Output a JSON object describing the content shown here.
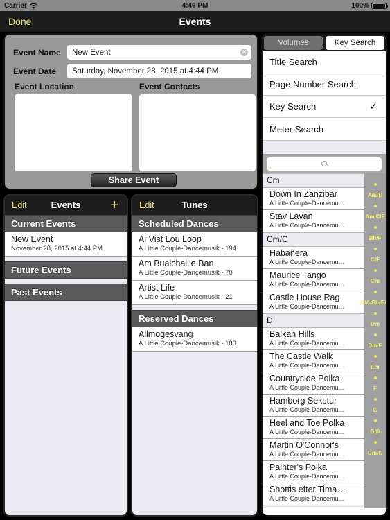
{
  "statusbar": {
    "carrier": "Carrier",
    "wifi_icon": "wifi-icon",
    "time": "4:46 PM",
    "battery_percent": "100%"
  },
  "navbar": {
    "done_label": "Done",
    "title": "Events"
  },
  "accent_color": "#e8e37a",
  "event_form": {
    "name_label": "Event Name",
    "name_value": "New Event",
    "name_placeholder": "Event Name",
    "clear_icon": "clear-circle-icon",
    "date_label": "Event Date",
    "date_value": "Saturday, November 28, 2015 at 4:44 PM",
    "location_label": "Event Location",
    "location_value": "",
    "contacts_label": "Event Contacts",
    "contacts_value": "",
    "share_label": "Share Event"
  },
  "events_panel": {
    "edit_label": "Edit",
    "title": "Events",
    "add_icon": "plus-icon",
    "sections": [
      {
        "header": "Current Events",
        "rows": [
          {
            "title": "New Event",
            "subtitle": "November 28, 2015 at 4:44 PM"
          }
        ]
      },
      {
        "header": "Future Events",
        "rows": []
      },
      {
        "header": "Past Events",
        "rows": []
      }
    ]
  },
  "tunes_panel": {
    "edit_label": "Edit",
    "title": "Tunes",
    "sections": [
      {
        "header": "Scheduled Dances",
        "rows": [
          {
            "title": "Ai Vist Lou Loop",
            "subtitle": "A Little Couple-Dancemusik - 194"
          },
          {
            "title": "Am Buaichaille Ban",
            "subtitle": "A Little Couple-Dancemusik - 70"
          },
          {
            "title": "Artist Life",
            "subtitle": "A Little Couple-Dancemusik - 21"
          }
        ]
      },
      {
        "header": "Reserved Dances",
        "rows": [
          {
            "title": "Allmogesvang",
            "subtitle": "A Little Couple-Dancemusik - 183"
          }
        ]
      }
    ]
  },
  "right_panel": {
    "segments": [
      {
        "label": "Volumes",
        "selected": false
      },
      {
        "label": "Key Search",
        "selected": true
      }
    ],
    "options": [
      {
        "label": "Title Search",
        "checked": false
      },
      {
        "label": "Page Number Search",
        "checked": false
      },
      {
        "label": "Key Search",
        "checked": true
      },
      {
        "label": "Meter Search",
        "checked": false
      }
    ],
    "check_icon": "checkmark-icon",
    "search": {
      "placeholder": "",
      "value": "",
      "icon": "search-icon"
    },
    "key_sections": [
      {
        "header": "Cm",
        "rows": [
          {
            "title": "Down In Zanzibar",
            "subtitle": "A Little Couple-Dancemu…"
          },
          {
            "title": "Stav Lavan",
            "subtitle": "A Little Couple-Dancemu…"
          }
        ]
      },
      {
        "header": "Cm/C",
        "rows": [
          {
            "title": "Habañera",
            "subtitle": "A Little Couple-Dancemu…"
          },
          {
            "title": "Maurice Tango",
            "subtitle": "A Little Couple-Dancemu…"
          },
          {
            "title": "Castle House Rag",
            "subtitle": "A Little Couple-Dancemu…"
          }
        ]
      },
      {
        "header": "D",
        "rows": [
          {
            "title": "Balkan Hills",
            "subtitle": "A Little Couple-Dancemu…"
          },
          {
            "title": "The Castle Walk",
            "subtitle": "A Little Couple-Dancemu…"
          },
          {
            "title": "Countryside Polka",
            "subtitle": "A Little Couple-Dancemu…"
          },
          {
            "title": "Hamborg Sekstur",
            "subtitle": "A Little Couple-Dancemu…"
          },
          {
            "title": "Heel and Toe Polka",
            "subtitle": "A Little Couple-Dancemu…"
          },
          {
            "title": "Martin O'Connor's",
            "subtitle": "A Little Couple-Dancemu…"
          },
          {
            "title": "Painter's Polka",
            "subtitle": "A Little Couple-Dancemu…"
          },
          {
            "title": "Shottis efter Tima…",
            "subtitle": "A Little Couple-Dancemu…"
          }
        ]
      }
    ],
    "index_entries": [
      {
        "type": "dot"
      },
      {
        "type": "label",
        "label": "A/E/D"
      },
      {
        "type": "dot"
      },
      {
        "type": "label",
        "label": "Am/C/F"
      },
      {
        "type": "dot"
      },
      {
        "type": "label",
        "label": "Bb/F"
      },
      {
        "type": "dot"
      },
      {
        "type": "label",
        "label": "C/F"
      },
      {
        "type": "dot"
      },
      {
        "type": "label",
        "label": "Cm"
      },
      {
        "type": "dot"
      },
      {
        "type": "label",
        "label": "D/A/Bb/G/F"
      },
      {
        "type": "dot"
      },
      {
        "type": "label",
        "label": "Dm"
      },
      {
        "type": "dot"
      },
      {
        "type": "label",
        "label": "Dm/F"
      },
      {
        "type": "dot"
      },
      {
        "type": "label",
        "label": "Em"
      },
      {
        "type": "dot"
      },
      {
        "type": "label",
        "label": "F"
      },
      {
        "type": "dot"
      },
      {
        "type": "label",
        "label": "G"
      },
      {
        "type": "dot"
      },
      {
        "type": "label",
        "label": "G/D"
      },
      {
        "type": "dot"
      },
      {
        "type": "label",
        "label": "Gm/G"
      }
    ]
  }
}
